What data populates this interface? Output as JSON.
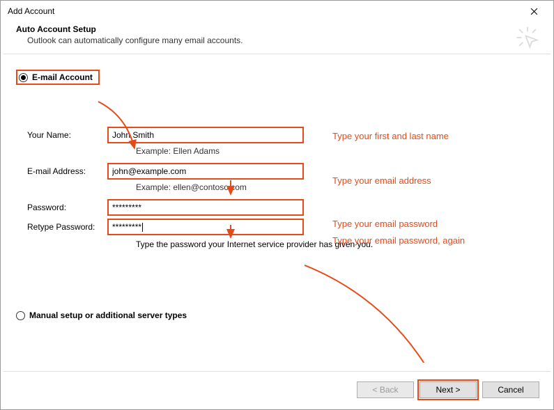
{
  "window": {
    "title": "Add Account"
  },
  "header": {
    "title": "Auto Account Setup",
    "subtitle": "Outlook can automatically configure many email accounts."
  },
  "radio": {
    "email_account": "E-mail Account",
    "manual": "Manual setup or additional server types"
  },
  "form": {
    "name_label": "Your Name:",
    "name_value": "John Smith",
    "name_example": "Example: Ellen Adams",
    "email_label": "E-mail Address:",
    "email_value": "john@example.com",
    "email_example": "Example: ellen@contoso.com",
    "password_label": "Password:",
    "password_value": "*********",
    "retype_label": "Retype Password:",
    "retype_value": "*********",
    "password_note": "Type the password your Internet service provider has given you."
  },
  "hints": {
    "name": "Type your first and last name",
    "email": "Type your email address",
    "password": "Type your email password",
    "retype": "Type your email password, again"
  },
  "buttons": {
    "back": "< Back",
    "next": "Next >",
    "cancel": "Cancel"
  },
  "colors": {
    "annotation": "#e64a19"
  }
}
